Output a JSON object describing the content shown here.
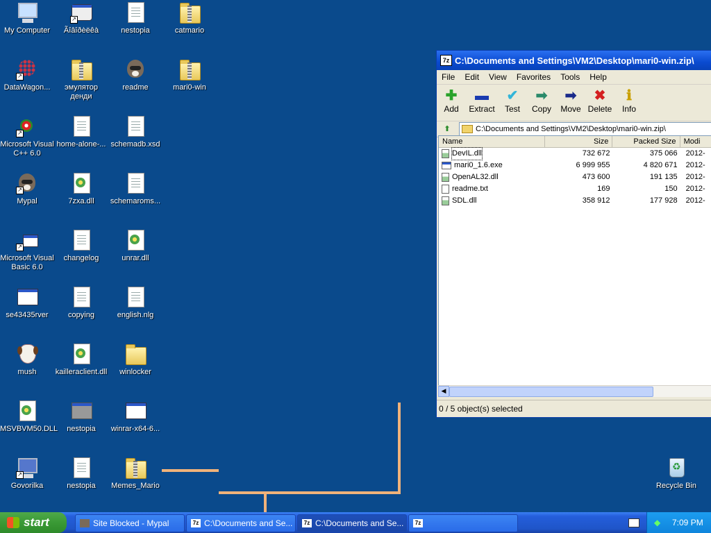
{
  "desktop": {
    "icons": [
      {
        "label": "My Computer"
      },
      {
        "label": "Ãîâîðèëêà"
      },
      {
        "label": "nestopia"
      },
      {
        "label": "catmario"
      },
      {
        "label": "DataWagon..."
      },
      {
        "label": "эмулятор денди"
      },
      {
        "label": "readme"
      },
      {
        "label": "mari0-win"
      },
      {
        "label": "Microsoft Visual C++ 6.0"
      },
      {
        "label": "home-alone-..."
      },
      {
        "label": "schemadb.xsd"
      },
      {
        "label": "Mypal"
      },
      {
        "label": "7zxa.dll"
      },
      {
        "label": "schemaroms..."
      },
      {
        "label": "Microsoft Visual Basic 6.0"
      },
      {
        "label": "changelog"
      },
      {
        "label": "unrar.dll"
      },
      {
        "label": "se43435rver"
      },
      {
        "label": "copying"
      },
      {
        "label": "english.nlg"
      },
      {
        "label": "mush"
      },
      {
        "label": "kailleraclient.dll"
      },
      {
        "label": "winlocker"
      },
      {
        "label": "MSVBVM50.DLL"
      },
      {
        "label": "nestopia"
      },
      {
        "label": "winrar-x64-6..."
      },
      {
        "label": "Govorilka"
      },
      {
        "label": "nestopia"
      },
      {
        "label": "Memes_Mario"
      },
      {
        "label": "Recycle Bin"
      }
    ]
  },
  "window": {
    "app_icon": "7z",
    "title": "C:\\Documents and Settings\\VM2\\Desktop\\mari0-win.zip\\",
    "menu": [
      "File",
      "Edit",
      "View",
      "Favorites",
      "Tools",
      "Help"
    ],
    "toolbar": [
      "Add",
      "Extract",
      "Test",
      "Copy",
      "Move",
      "Delete",
      "Info"
    ],
    "address": "C:\\Documents and Settings\\VM2\\Desktop\\mari0-win.zip\\",
    "columns": [
      "Name",
      "Size",
      "Packed Size",
      "Modi"
    ],
    "files": [
      {
        "name": "DevIL.dll",
        "size": "732 672",
        "packed": "375 066",
        "modified": "2012-"
      },
      {
        "name": "mari0_1.6.exe",
        "size": "6 999 955",
        "packed": "4 820 671",
        "modified": "2012-"
      },
      {
        "name": "OpenAL32.dll",
        "size": "473 600",
        "packed": "191 135",
        "modified": "2012-"
      },
      {
        "name": "readme.txt",
        "size": "169",
        "packed": "150",
        "modified": "2012-"
      },
      {
        "name": "SDL.dll",
        "size": "358 912",
        "packed": "177 928",
        "modified": "2012-"
      }
    ],
    "status": "0 / 5 object(s) selected"
  },
  "taskbar": {
    "start": "start",
    "tasks": [
      {
        "label": "Site Blocked - Mypal"
      },
      {
        "label": "C:\\Documents and Se..."
      },
      {
        "label": "C:\\Documents and Se..."
      },
      {
        "label": ""
      }
    ],
    "clock": "7:09 PM"
  }
}
